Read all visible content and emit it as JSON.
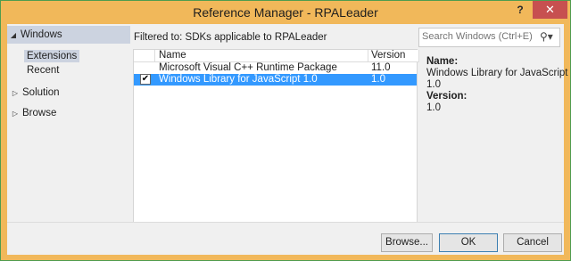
{
  "window": {
    "title": "Reference Manager - RPALeader",
    "help_label": "?",
    "close_label": "✕"
  },
  "sidebar": {
    "sections": [
      {
        "label": "Windows",
        "expanded": true,
        "children": [
          {
            "label": "Extensions",
            "selected": true
          },
          {
            "label": "Recent",
            "selected": false
          }
        ]
      },
      {
        "label": "Solution",
        "expanded": false
      },
      {
        "label": "Browse",
        "expanded": false
      }
    ]
  },
  "filter": {
    "text": "Filtered to: SDKs applicable to RPALeader"
  },
  "search": {
    "placeholder": "Search Windows (Ctrl+E)"
  },
  "table": {
    "columns": [
      "Name",
      "Version"
    ],
    "rows": [
      {
        "name": "Microsoft Visual C++ Runtime Package",
        "version": "11.0",
        "checked": false,
        "selected": false
      },
      {
        "name": "Windows Library for JavaScript 1.0",
        "version": "1.0",
        "checked": true,
        "selected": true
      }
    ]
  },
  "details": {
    "name_label": "Name:",
    "name_value_lines": [
      "Windows Library for JavaScript",
      "1.0"
    ],
    "version_label": "Version:",
    "version_value": "1.0"
  },
  "buttons": {
    "browse": "Browse...",
    "ok": "OK",
    "cancel": "Cancel"
  },
  "colors": {
    "title_bar": "#f1b85a",
    "selection": "#3399ff",
    "close": "#c75050",
    "sidebar_highlight": "#ccd3e0"
  }
}
